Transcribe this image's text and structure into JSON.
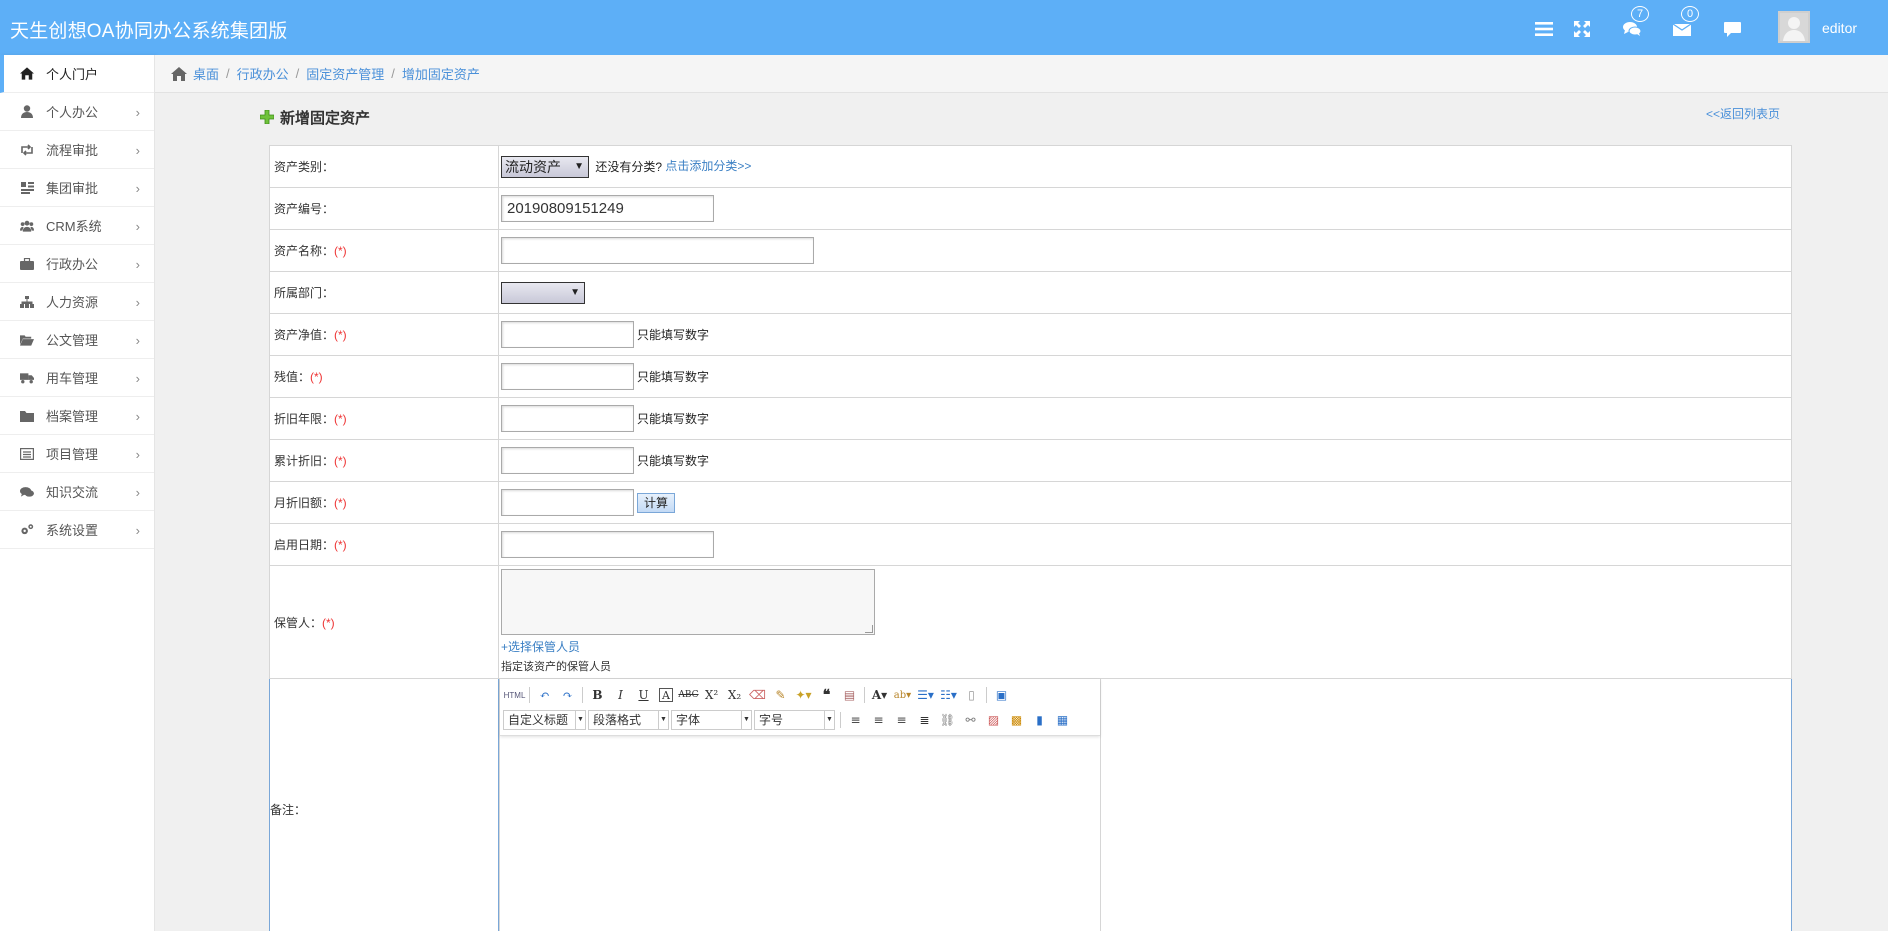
{
  "app": {
    "title": "天生创想OA协同办公系统集团版",
    "username": "editor"
  },
  "topbar": {
    "messages_badge": "7",
    "mail_badge": "0"
  },
  "sidebar": {
    "items": [
      {
        "label": "个人门户",
        "icon": "home-icon"
      },
      {
        "label": "个人办公",
        "icon": "user-icon"
      },
      {
        "label": "流程审批",
        "icon": "retweet-icon"
      },
      {
        "label": "集团审批",
        "icon": "dashboard-icon"
      },
      {
        "label": "CRM系统",
        "icon": "users-icon"
      },
      {
        "label": "行政办公",
        "icon": "briefcase-icon"
      },
      {
        "label": "人力资源",
        "icon": "sitemap-icon"
      },
      {
        "label": "公文管理",
        "icon": "folder-open-icon"
      },
      {
        "label": "用车管理",
        "icon": "truck-icon"
      },
      {
        "label": "档案管理",
        "icon": "folder-icon"
      },
      {
        "label": "项目管理",
        "icon": "list-alt-icon"
      },
      {
        "label": "知识交流",
        "icon": "comments-icon"
      },
      {
        "label": "系统设置",
        "icon": "cogs-icon"
      }
    ]
  },
  "breadcrumb": {
    "items": [
      "桌面",
      "行政办公",
      "固定资产管理",
      "增加固定资产"
    ]
  },
  "panel": {
    "title": "新增固定资产",
    "back_link": "<<返回列表页"
  },
  "form": {
    "required_mark": "(*)",
    "category": {
      "label": "资产类别：",
      "value": "流动资产",
      "hint": "还没有分类?",
      "link": "点击添加分类>>"
    },
    "asset_no": {
      "label": "资产编号：",
      "value": "20190809151249"
    },
    "asset_name": {
      "label": "资产名称：",
      "value": ""
    },
    "department": {
      "label": "所属部门：",
      "value": ""
    },
    "net_value": {
      "label": "资产净值：",
      "hint": "只能填写数字"
    },
    "residual": {
      "label": "残值：",
      "hint": "只能填写数字"
    },
    "dep_years": {
      "label": "折旧年限：",
      "hint": "只能填写数字"
    },
    "acc_dep": {
      "label": "累计折旧：",
      "hint": "只能填写数字"
    },
    "monthly_dep": {
      "label": "月折旧额：",
      "button": "计算"
    },
    "start_date": {
      "label": "启用日期："
    },
    "keeper": {
      "label": "保管人：",
      "link": "+选择保管人员",
      "hint": "指定该资产的保管人员"
    },
    "remark": {
      "label": "备注："
    }
  },
  "editor": {
    "combos": [
      "自定义标题",
      "段落格式",
      "字体",
      "字号"
    ]
  }
}
